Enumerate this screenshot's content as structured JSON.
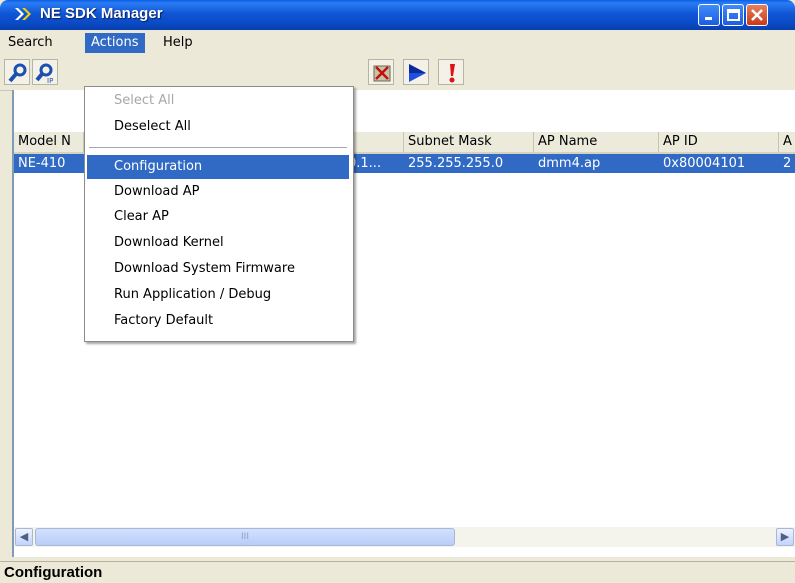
{
  "window": {
    "title": "NE SDK Manager"
  },
  "menubar": {
    "items": [
      "Search",
      "Actions",
      "Help"
    ]
  },
  "actions_menu": {
    "items": [
      {
        "label": "Select All"
      },
      {
        "label": "Deselect All"
      },
      {
        "label": "Configuration"
      },
      {
        "label": "Download AP"
      },
      {
        "label": "Clear AP"
      },
      {
        "label": "Download Kernel"
      },
      {
        "label": "Download System Firmware"
      },
      {
        "label": "Run Application / Debug"
      },
      {
        "label": "Factory Default"
      }
    ]
  },
  "table": {
    "columns": [
      "Model N",
      "",
      "Subnet Mask",
      "AP Name",
      "AP ID",
      "A"
    ],
    "rows": [
      {
        "model": "NE-410",
        "ip": "0.1...",
        "subnet_mask": "255.255.255.0",
        "ap_name": "dmm4.ap",
        "ap_id": "0x80004101",
        "extra": "2"
      }
    ]
  },
  "scrollbar": {
    "thumb_grip": "III"
  },
  "statusbar": {
    "text": "Configuration"
  },
  "colors": {
    "selection": "#316ac5",
    "title_blue": "#0a49c4",
    "close_red": "#c8391b"
  },
  "icons": [
    "search-icon",
    "search-ip-icon",
    "clear-icon",
    "play-icon",
    "alert-icon",
    "minimize-icon",
    "maximize-icon",
    "close-icon"
  ]
}
